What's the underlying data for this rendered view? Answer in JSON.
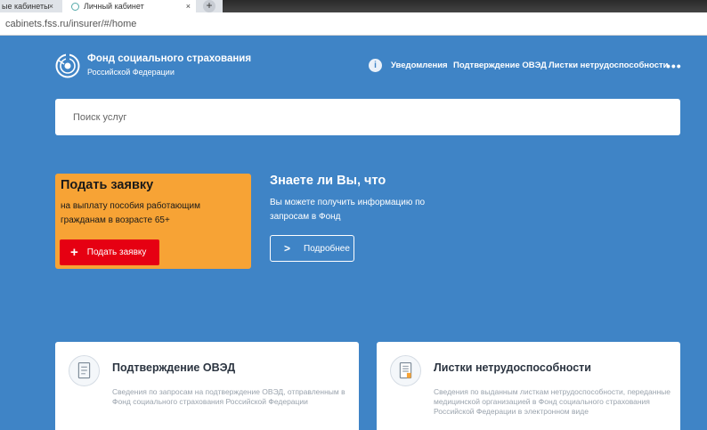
{
  "browser": {
    "tabs": [
      {
        "label": "ые кабинеты"
      },
      {
        "label": "Личный кабинет"
      }
    ],
    "new_tab_symbol": "+",
    "close_symbol": "×",
    "url": "cabinets.fss.ru/insurer/#/home"
  },
  "header": {
    "brand_title": "Фонд социального страхования",
    "brand_subtitle": "Российской Федерации",
    "info_symbol": "i",
    "nav": [
      {
        "label": "Уведомления"
      },
      {
        "label": "Подтверждение ОВЭД"
      },
      {
        "label": "Листки нетрудоспособности"
      }
    ],
    "more_symbol": "•••"
  },
  "search": {
    "placeholder": "Поиск услуг"
  },
  "apply_card": {
    "title": "Подать заявку",
    "description": "на выплату пособия работающим гражданам в возрасте 65+",
    "button_label": "Подать заявку",
    "color": "#f7a335",
    "button_color": "#e60012"
  },
  "know": {
    "title": "Знаете ли Вы, что",
    "description": "Вы можете получить информацию по запросам в Фонд",
    "button_label": "Подробнее"
  },
  "cards": [
    {
      "title": "Подтверждение ОВЭД",
      "description": "Сведения по запросам на подтверждение ОВЭД, отправленным в Фонд социального страхования Российской Федерации",
      "icon": "document-stack-icon"
    },
    {
      "title": "Листки нетрудоспособности",
      "description": "Сведения по выданным листкам нетрудоспособности, переданные медицинской организацией в Фонд социального страхования Российской Федерации в электронном виде",
      "icon": "sick-leave-icon"
    }
  ],
  "colors": {
    "background": "#3f84c6",
    "accent": "#e60012"
  }
}
